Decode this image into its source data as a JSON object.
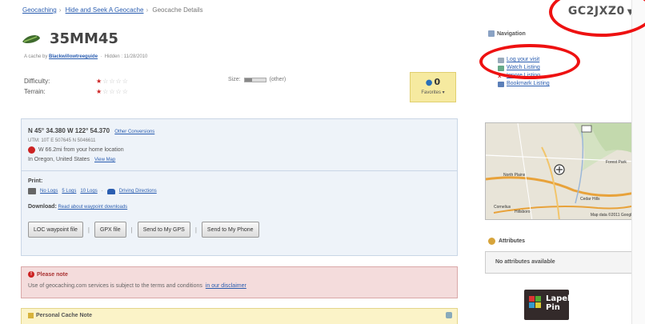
{
  "breadcrumb": [
    "Geocaching",
    "Hide and Seek A Geocache",
    "Geocache Details"
  ],
  "header": {
    "gc_code": "GC2JXZ0",
    "gc_code_caret": "▼",
    "cache_name": "35MM45",
    "byline_prefix": "A cache by",
    "owner": "Blackwillowtreeguide",
    "hidden": "Hidden : 11/28/2010"
  },
  "ratings": {
    "difficulty_label": "Difficulty:",
    "terrain_label": "Terrain:",
    "difficulty_stars": "★",
    "difficulty_off": "☆☆☆☆",
    "terrain_stars": "★",
    "terrain_off": "☆☆☆☆",
    "size_label": "Size:",
    "size_word": "(other)",
    "size_level": 0.35
  },
  "favorites": {
    "count": "0",
    "label": "Favorites ▾"
  },
  "location": {
    "coords": "N 45° 34.380 W 122° 54.370",
    "other_conversions": "Other Conversions",
    "utm": "UTM: 10T E 507645 N 5046611",
    "distance": "W 66.2mi from your home location",
    "state": "In Oregon, United States",
    "view_map": "View Map"
  },
  "print": {
    "label": "Print:",
    "links": [
      "No Logs",
      "5 Logs",
      "10 Logs"
    ],
    "driving": "Driving Directions"
  },
  "download": {
    "label": "Download:",
    "link": "Read about waypoint downloads"
  },
  "buttons": [
    "LOC waypoint file",
    "GPX file",
    "Send to My GPS",
    "Send to My Phone"
  ],
  "notice": {
    "title": "Please note",
    "text": "Use of geocaching.com services is subject to the terms and conditions",
    "link": "in our disclaimer"
  },
  "personal_note": {
    "title": "Personal Cache Note"
  },
  "navigation": {
    "title": "Navigation",
    "items": [
      "Log your visit",
      "Watch Listing",
      "Ignore Listing",
      "Bookmark Listing"
    ]
  },
  "map": {
    "labels": [
      "North Plains",
      "Forest Park",
      "Cornelius",
      "Cedar Hills",
      "Hillsboro"
    ],
    "attribution": "Map data ©2011 Google"
  },
  "attributes": {
    "title": "Attributes",
    "empty": "No attributes available"
  },
  "promo": {
    "line1": "Lapel",
    "line2": "Pin"
  },
  "colors": {
    "link": "#2a5db0",
    "highlight_ellipse": "#ee1111",
    "favorites_bg": "#f6eaa0",
    "notice_bg": "#f4dcdc",
    "panel_bg": "#eef3f9"
  }
}
